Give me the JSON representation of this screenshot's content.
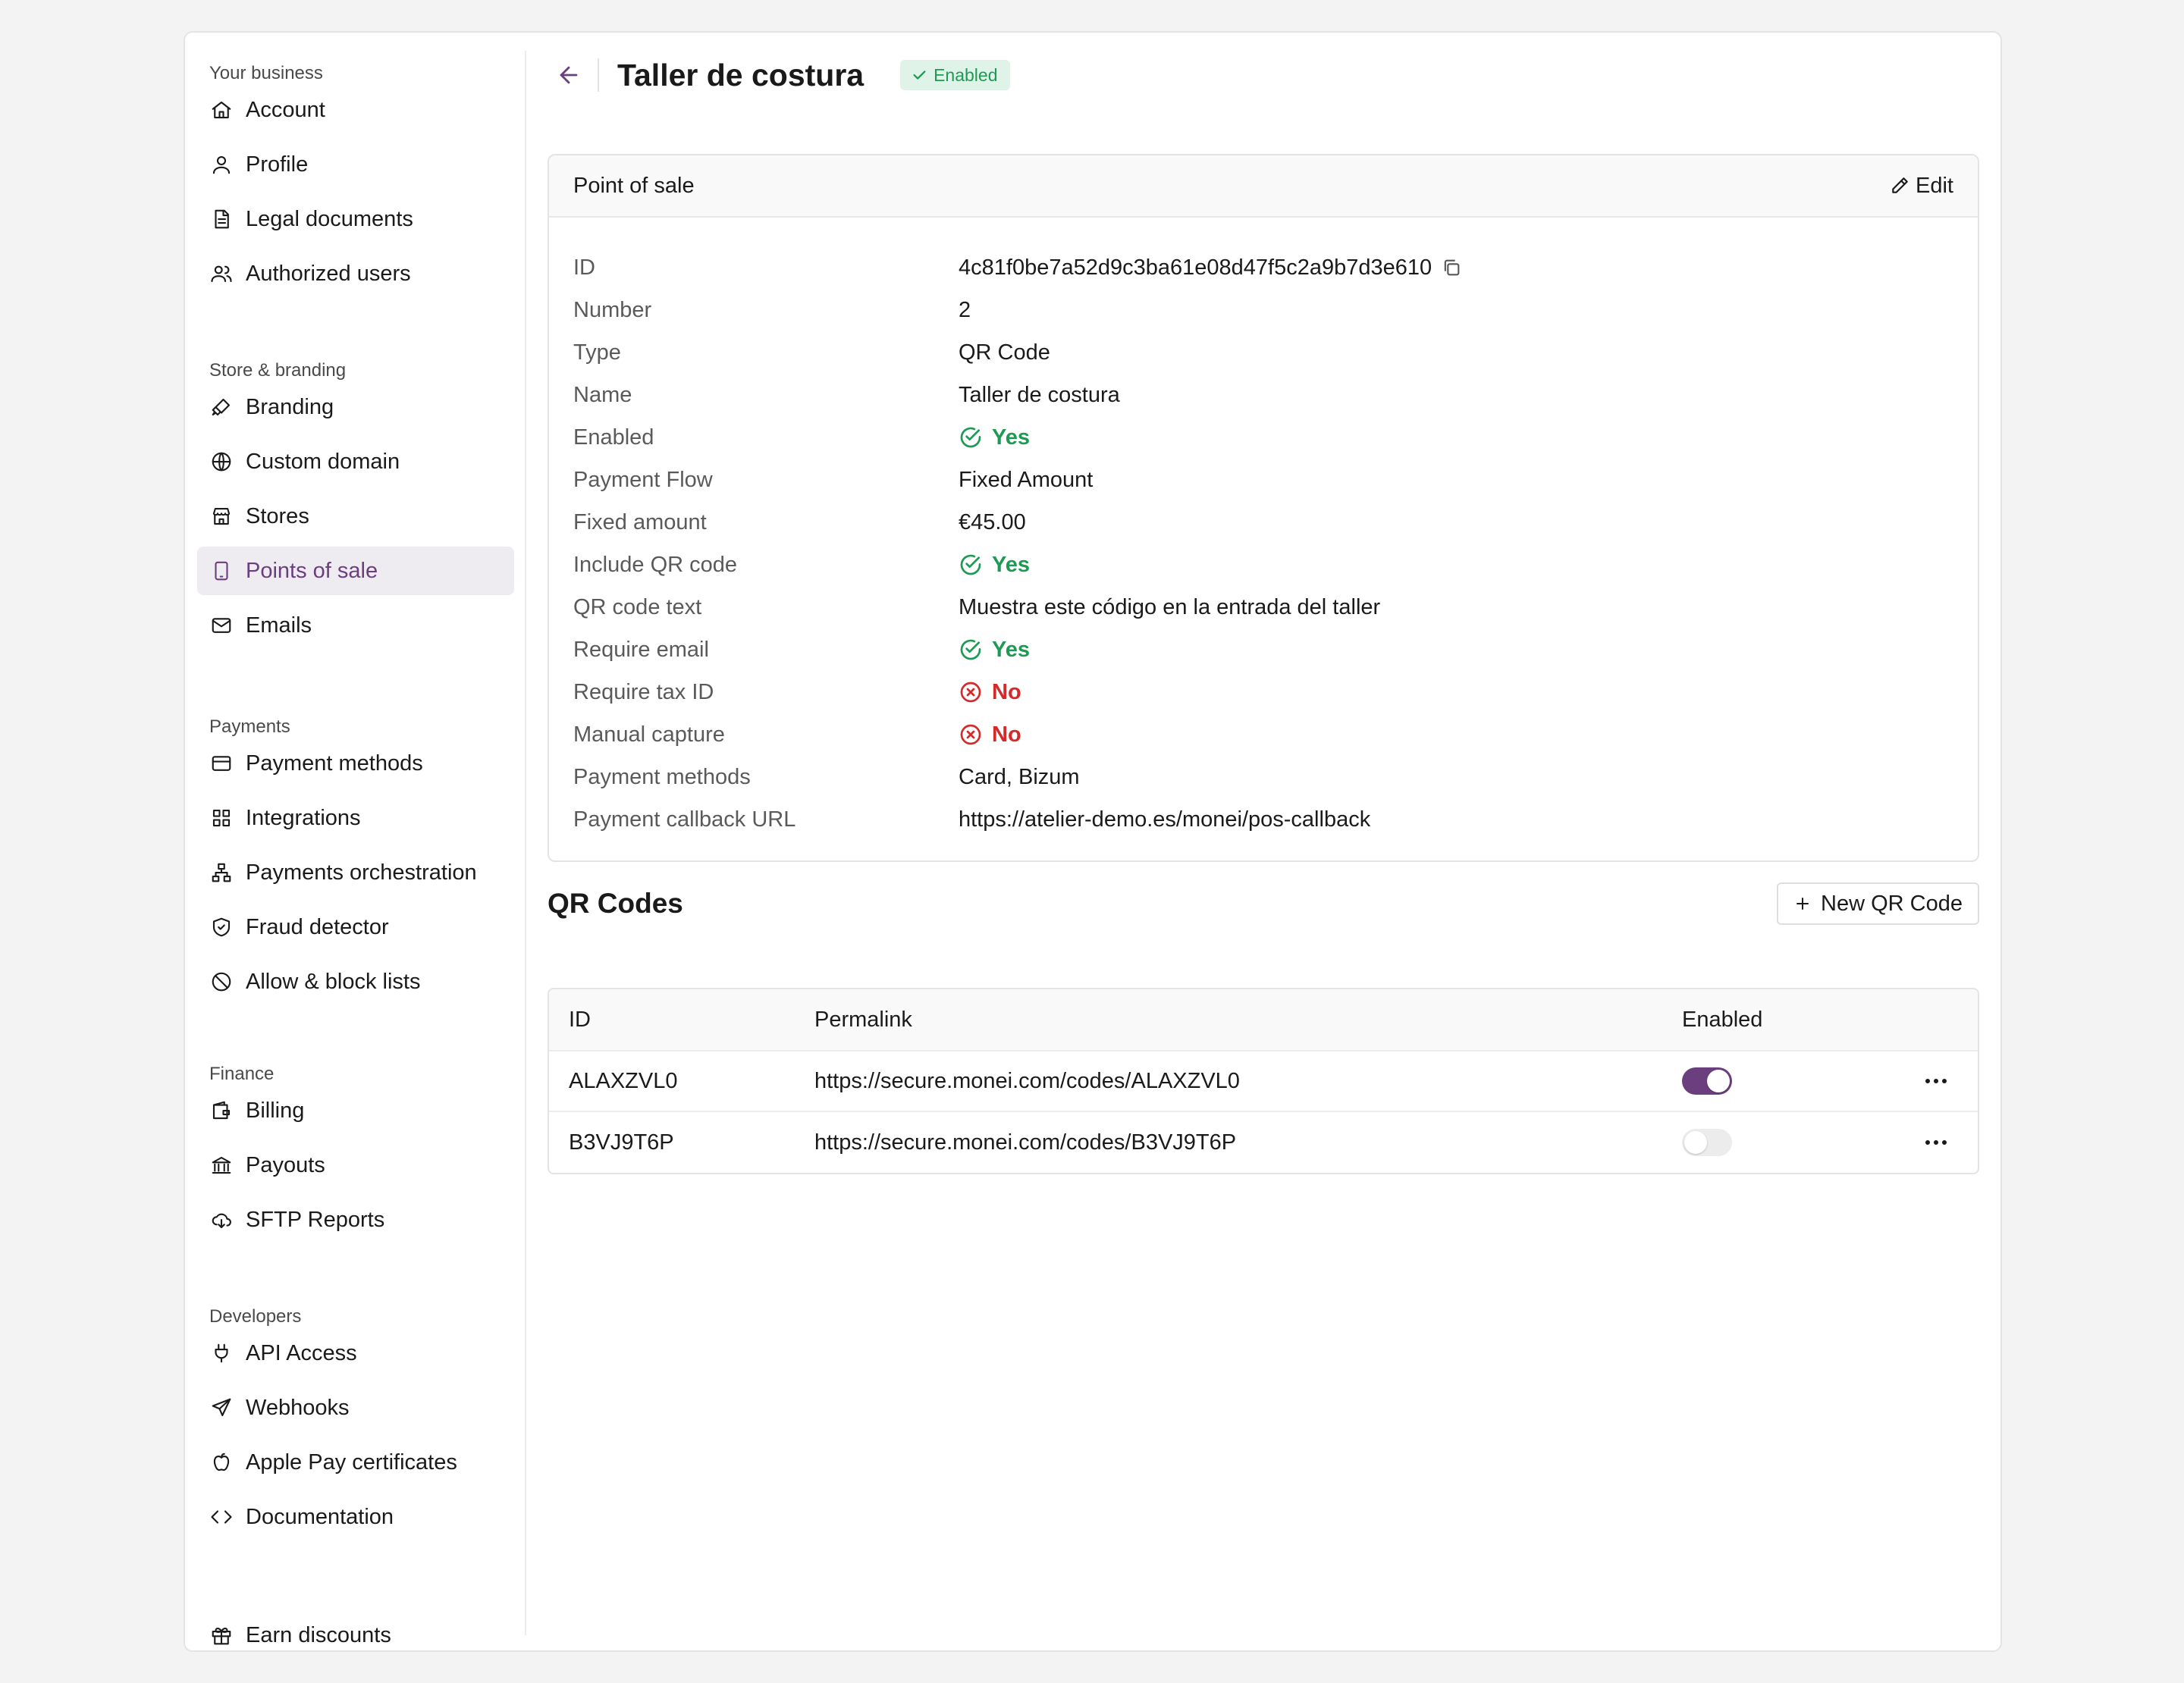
{
  "sidebar": {
    "sections": [
      {
        "label": "Your business",
        "items": [
          {
            "label": "Account",
            "icon": "home-icon"
          },
          {
            "label": "Profile",
            "icon": "user-icon"
          },
          {
            "label": "Legal documents",
            "icon": "document-icon"
          },
          {
            "label": "Authorized users",
            "icon": "users-icon"
          }
        ]
      },
      {
        "label": "Store & branding",
        "items": [
          {
            "label": "Branding",
            "icon": "brush-icon"
          },
          {
            "label": "Custom domain",
            "icon": "globe-icon"
          },
          {
            "label": "Stores",
            "icon": "store-icon"
          },
          {
            "label": "Points of sale",
            "icon": "tablet-icon",
            "active": true
          },
          {
            "label": "Emails",
            "icon": "mail-icon"
          }
        ]
      },
      {
        "label": "Payments",
        "items": [
          {
            "label": "Payment methods",
            "icon": "credit-card-icon"
          },
          {
            "label": "Integrations",
            "icon": "grid-icon"
          },
          {
            "label": "Payments orchestration",
            "icon": "network-icon"
          },
          {
            "label": "Fraud detector",
            "icon": "shield-icon"
          },
          {
            "label": "Allow & block lists",
            "icon": "ban-icon"
          }
        ]
      },
      {
        "label": "Finance",
        "items": [
          {
            "label": "Billing",
            "icon": "wallet-icon"
          },
          {
            "label": "Payouts",
            "icon": "bank-icon"
          },
          {
            "label": "SFTP Reports",
            "icon": "cloud-download-icon"
          }
        ]
      },
      {
        "label": "Developers",
        "items": [
          {
            "label": "API Access",
            "icon": "plug-icon"
          },
          {
            "label": "Webhooks",
            "icon": "send-icon"
          },
          {
            "label": "Apple Pay certificates",
            "icon": "apple-icon"
          },
          {
            "label": "Documentation",
            "icon": "code-icon"
          }
        ]
      }
    ],
    "footer_item": {
      "label": "Earn discounts",
      "icon": "gift-icon"
    }
  },
  "header": {
    "title": "Taller de costura",
    "status_badge": "Enabled"
  },
  "card": {
    "title": "Point of sale",
    "edit_label": "Edit",
    "rows": [
      {
        "label": "ID",
        "value": "4c81f0be7a52d9c3ba61e08d47f5c2a9b7d3e610",
        "kind": "copy"
      },
      {
        "label": "Number",
        "value": "2"
      },
      {
        "label": "Type",
        "value": "QR Code"
      },
      {
        "label": "Name",
        "value": "Taller de costura"
      },
      {
        "label": "Enabled",
        "value": "Yes",
        "kind": "yes"
      },
      {
        "label": "Payment Flow",
        "value": "Fixed Amount"
      },
      {
        "label": "Fixed amount",
        "value": "€45.00"
      },
      {
        "label": "Include QR code",
        "value": "Yes",
        "kind": "yes"
      },
      {
        "label": "QR code text",
        "value": "Muestra este código en la entrada del taller"
      },
      {
        "label": "Require email",
        "value": "Yes",
        "kind": "yes"
      },
      {
        "label": "Require tax ID",
        "value": "No",
        "kind": "no"
      },
      {
        "label": "Manual capture",
        "value": "No",
        "kind": "no"
      },
      {
        "label": "Payment methods",
        "value": "Card, Bizum"
      },
      {
        "label": "Payment callback URL",
        "value": "https://atelier-demo.es/monei/pos-callback"
      }
    ]
  },
  "qr_codes": {
    "title": "QR Codes",
    "new_button_label": "New QR Code",
    "columns": {
      "id": "ID",
      "permalink": "Permalink",
      "enabled": "Enabled"
    },
    "rows": [
      {
        "id": "ALAXZVL0",
        "permalink": "https://secure.monei.com/codes/ALAXZVL0",
        "enabled": true
      },
      {
        "id": "B3VJ9T6P",
        "permalink": "https://secure.monei.com/codes/B3VJ9T6P",
        "enabled": false
      }
    ]
  },
  "colors": {
    "accent": "#6b3f7e",
    "active_bg": "#eeebf1",
    "success": "#1e9a55",
    "danger": "#d42a2a"
  }
}
